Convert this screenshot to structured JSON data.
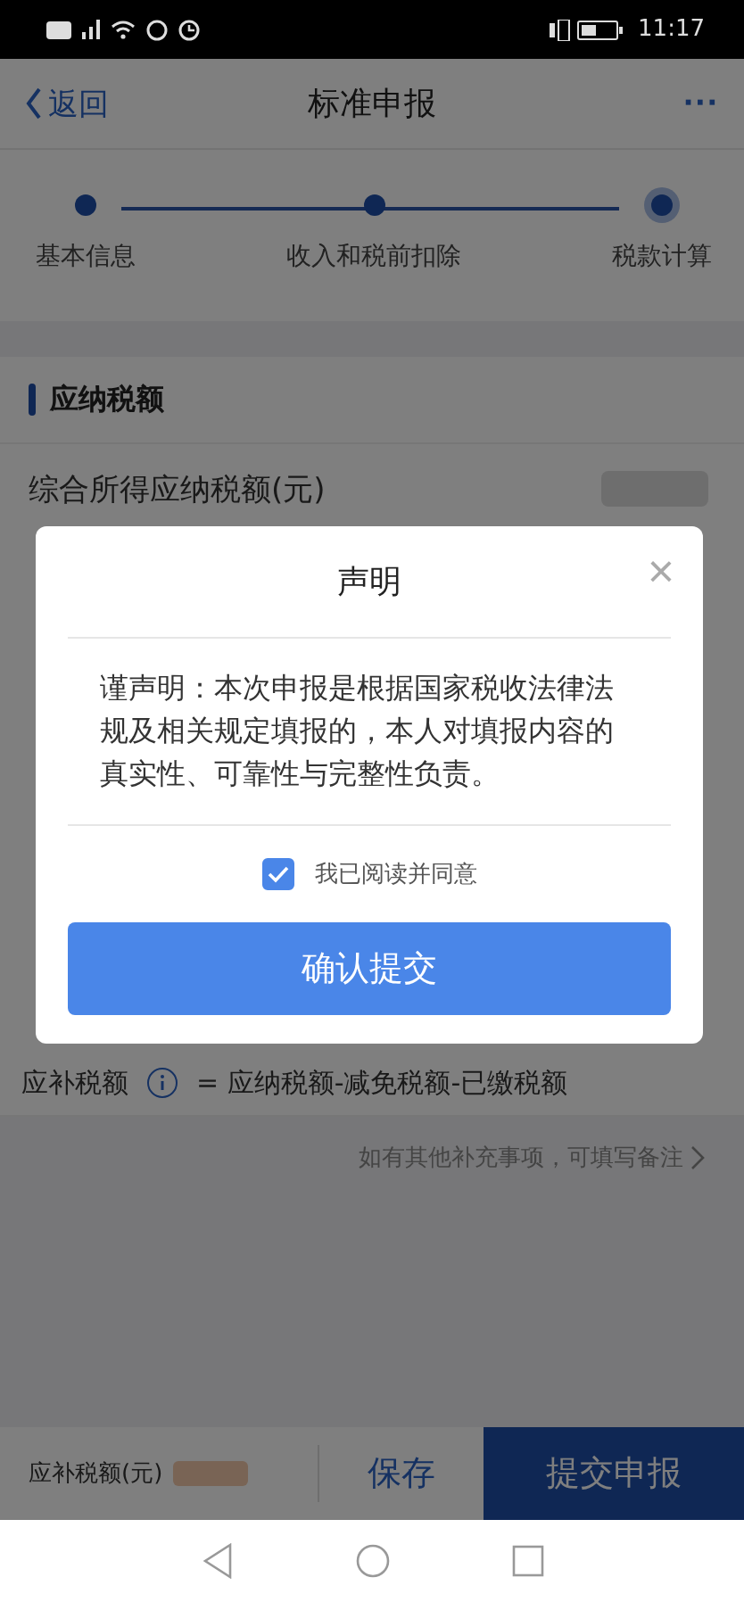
{
  "status_bar": {
    "time": "11:17"
  },
  "nav": {
    "back": "返回",
    "title": "标准申报",
    "more": "···"
  },
  "steps": [
    {
      "label": "基本信息",
      "selected": false
    },
    {
      "label": "收入和税前扣除",
      "selected": false
    },
    {
      "label": "税款计算",
      "selected": true
    }
  ],
  "section": {
    "title": "应纳税额",
    "row_label": "综合所得应纳税额(元)"
  },
  "formula": {
    "label": "应补税额",
    "text": "= 应纳税额-减免税额-已缴税额"
  },
  "remark_link": "如有其他补充事项，可填写备注",
  "bottom_bar": {
    "label": "应补税额(元)",
    "save": "保存",
    "submit": "提交申报"
  },
  "dialog": {
    "title": "声明",
    "close": "×",
    "body": "谨声明：本次申报是根据国家税收法律法规及相关规定填报的，本人对填报内容的真实性、可靠性与完整性负责。",
    "agree": {
      "label": "我已阅读并同意",
      "checked": true
    },
    "confirm": "确认提交"
  }
}
